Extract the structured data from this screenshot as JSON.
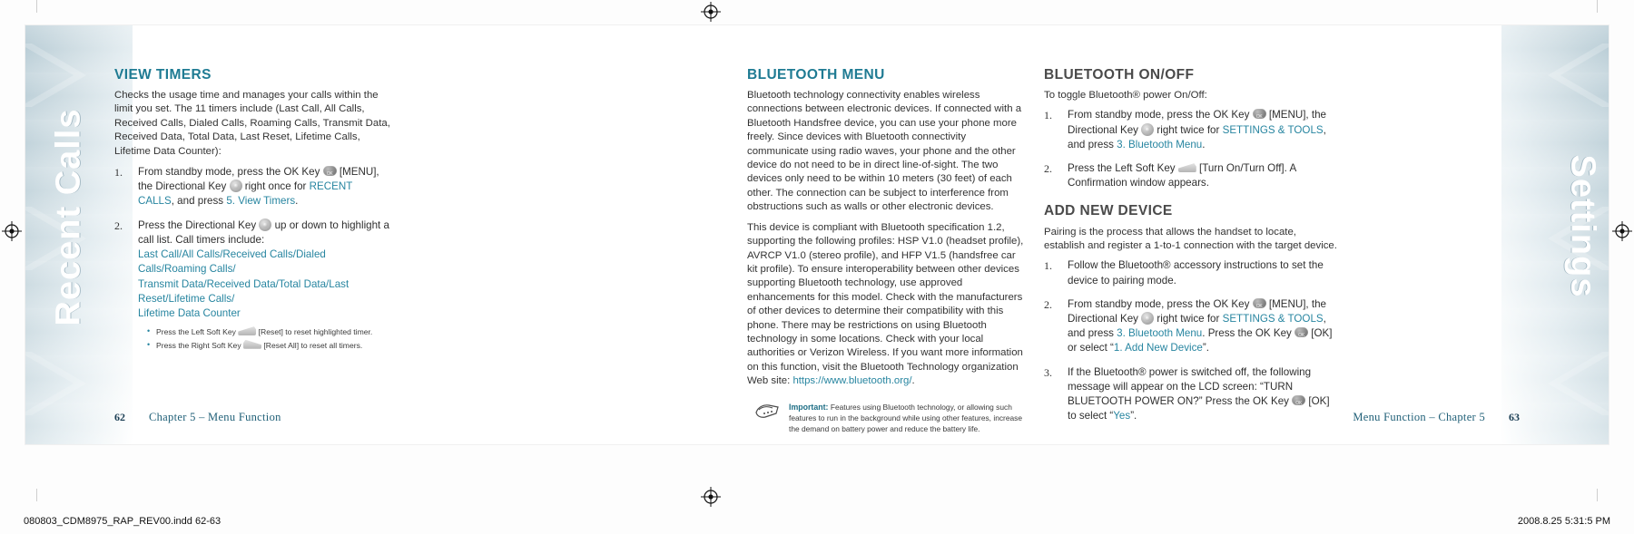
{
  "scan": {
    "file_label": "080803_CDM8975_RAP_REV00.indd   62-63",
    "timestamp": "2008.8.25   5:31:5 PM"
  },
  "left_page": {
    "tab_label": "Recent Calls",
    "section": {
      "title": "VIEW TIMERS",
      "intro": "Checks the usage time and manages your calls within the limit you set. The 11 timers include (Last Call, All Calls, Received Calls, Dialed Calls, Roaming Calls, Transmit Data, Received Data, Total Data, Last Reset, Lifetime Calls, Lifetime Data Counter):",
      "steps": [
        {
          "num": "1.",
          "parts": [
            {
              "t": "From standby mode, press the OK Key ",
              "style": "plain"
            },
            {
              "t": "okkey",
              "style": "icon"
            },
            {
              "t": " [MENU], the Directional Key ",
              "style": "plain"
            },
            {
              "t": "dirkey",
              "style": "icon"
            },
            {
              "t": " right once for ",
              "style": "plain"
            },
            {
              "t": "RECENT CALLS",
              "style": "link"
            },
            {
              "t": ", and press ",
              "style": "plain"
            },
            {
              "t": "5. View Timers",
              "style": "link"
            },
            {
              "t": ".",
              "style": "plain"
            }
          ]
        },
        {
          "num": "2.",
          "parts": [
            {
              "t": "Press the Directional Key ",
              "style": "plain"
            },
            {
              "t": "dirkey",
              "style": "icon"
            },
            {
              "t": " up or down to highlight a call list. Call timers include:",
              "style": "plain"
            }
          ],
          "list_line1": "Last Call/All Calls/Received Calls/Dialed Calls/Roaming Calls/",
          "list_line2": "Transmit Data/Received Data/Total Data/Last Reset/Lifetime Calls/",
          "list_line3": "Lifetime Data Counter",
          "subs": [
            {
              "before": "Press the Left Soft Key ",
              "icon": "softkey-left",
              "after": " [Reset] to reset highlighted timer."
            },
            {
              "before": "Press the Right Soft Key ",
              "icon": "softkey-right",
              "after": " [Reset All] to reset all timers."
            }
          ]
        }
      ]
    },
    "footer": {
      "page": "62",
      "title": "Chapter 5 – Menu Function"
    }
  },
  "right_page": {
    "tab_label": "Settings",
    "middle_column": {
      "title": "BLUETOOTH MENU",
      "paragraph1": "Bluetooth technology connectivity enables wireless connections between electronic devices. If connected with a Bluetooth Handsfree device, you can use your phone more freely. Since devices with Bluetooth connectivity communicate using radio waves, your phone and the other device do not need to be in direct line-of-sight. The two devices only need to be within 10 meters (30 feet) of each other. The connection can be subject to interference from obstructions such as walls or other electronic devices.",
      "paragraph2_pre": "This device is compliant with Bluetooth specification 1.2, supporting the following profiles: HSP V1.0 (headset profile), AVRCP V1.0 (stereo profile), and HFP V1.5 (handsfree car kit profile). To ensure interoperability between other devices supporting Bluetooth technology, use approved enhancements for this model. Check with the manufacturers of other devices to determine their compatibility with this phone. There may be restrictions on using Bluetooth technology in some locations. Check with your local authorities or Verizon Wireless. If you want more information on this function, visit the Bluetooth Technology organization Web site: ",
      "paragraph2_link": "https://www.bluetooth.org/",
      "paragraph2_post": ".",
      "note": {
        "label": "Important:",
        "text": "Features using Bluetooth technology, or allowing such features to run in the background while using other features, increase the demand on battery power and reduce the battery life.",
        "icon": "hands-note-icon"
      }
    },
    "right_column": {
      "section1": {
        "title": "BLUETOOTH ON/OFF",
        "intro": "To toggle Bluetooth® power On/Off:",
        "steps": [
          {
            "num": "1.",
            "parts": [
              {
                "t": "From standby mode, press the OK Key ",
                "style": "plain"
              },
              {
                "t": "okkey",
                "style": "icon"
              },
              {
                "t": " [MENU], the Directional Key ",
                "style": "plain"
              },
              {
                "t": "dirkey",
                "style": "icon"
              },
              {
                "t": " right twice for ",
                "style": "plain"
              },
              {
                "t": "SETTINGS & TOOLS",
                "style": "link"
              },
              {
                "t": ", and press ",
                "style": "plain"
              },
              {
                "t": "3. Bluetooth Menu",
                "style": "link"
              },
              {
                "t": ".",
                "style": "plain"
              }
            ]
          },
          {
            "num": "2.",
            "parts": [
              {
                "t": "Press the Left Soft Key ",
                "style": "plain"
              },
              {
                "t": "softkey-left",
                "style": "icon"
              },
              {
                "t": " [Turn On/Turn Off]. A Confirmation window appears.",
                "style": "plain"
              }
            ]
          }
        ]
      },
      "section2": {
        "title": "ADD NEW DEVICE",
        "intro": "Pairing is the process that allows the handset to locate, establish and register a 1-to-1 connection with the target device.",
        "steps": [
          {
            "num": "1.",
            "parts": [
              {
                "t": "Follow the Bluetooth® accessory instructions to set the device to pairing mode.",
                "style": "plain"
              }
            ]
          },
          {
            "num": "2.",
            "parts": [
              {
                "t": "From standby mode, press the OK Key ",
                "style": "plain"
              },
              {
                "t": "okkey",
                "style": "icon"
              },
              {
                "t": " [MENU], the Directional Key ",
                "style": "plain"
              },
              {
                "t": "dirkey",
                "style": "icon"
              },
              {
                "t": " right twice for ",
                "style": "plain"
              },
              {
                "t": "SETTINGS & TOOLS",
                "style": "link"
              },
              {
                "t": ", and press ",
                "style": "plain"
              },
              {
                "t": "3. Bluetooth Menu",
                "style": "link"
              },
              {
                "t": ". Press the OK Key ",
                "style": "plain"
              },
              {
                "t": "okkey",
                "style": "icon"
              },
              {
                "t": " [OK] or select “",
                "style": "plain"
              },
              {
                "t": "1. Add New Device",
                "style": "link"
              },
              {
                "t": "”.",
                "style": "plain"
              }
            ]
          },
          {
            "num": "3.",
            "parts": [
              {
                "t": "If the Bluetooth® power is switched off, the following message will appear on the LCD screen: “TURN BLUETOOTH POWER ON?” Press the OK Key ",
                "style": "plain"
              },
              {
                "t": "okkey",
                "style": "icon"
              },
              {
                "t": " [OK] to select “",
                "style": "plain"
              },
              {
                "t": "Yes",
                "style": "link"
              },
              {
                "t": "”.",
                "style": "plain"
              }
            ]
          }
        ]
      }
    },
    "footer": {
      "page": "63",
      "title": "Menu Function – Chapter 5"
    }
  },
  "colors": {
    "teal": "#1f7b93",
    "link": "#2785a0",
    "footer": "#1f5f77",
    "band": "#b9cdd6"
  }
}
